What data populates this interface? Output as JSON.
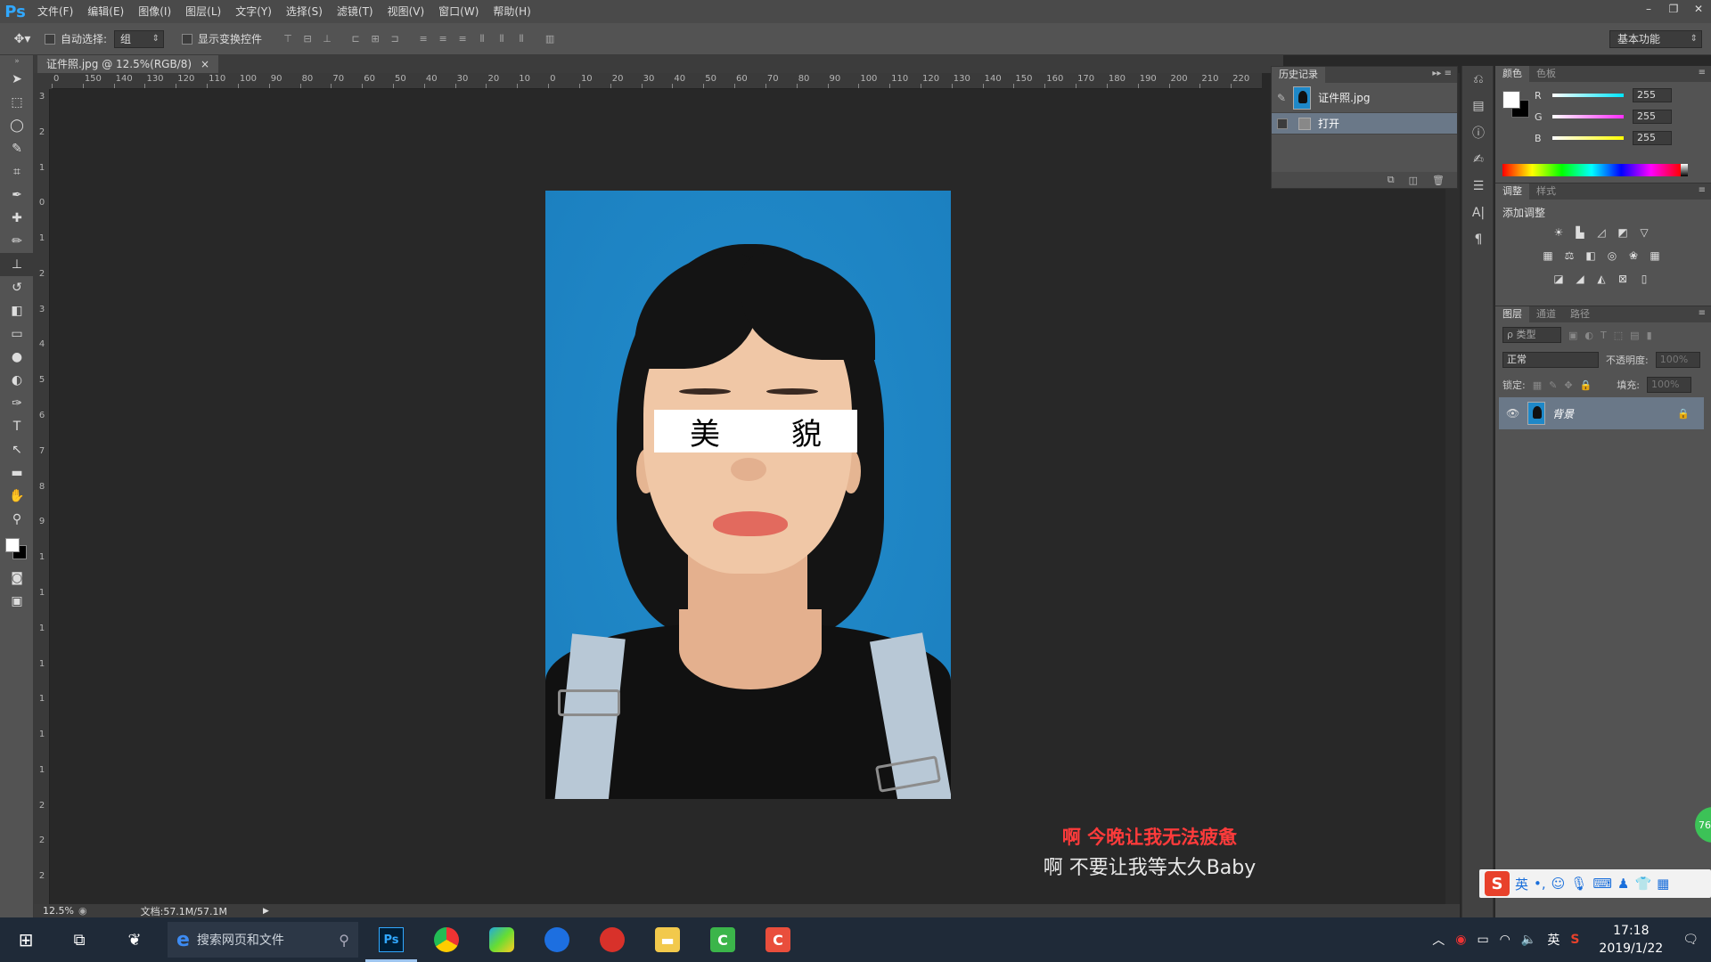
{
  "app": {
    "logo": "Ps",
    "window_controls": [
      "–",
      "❐",
      "✕"
    ]
  },
  "menu": [
    "文件(F)",
    "编辑(E)",
    "图像(I)",
    "图层(L)",
    "文字(Y)",
    "选择(S)",
    "滤镜(T)",
    "视图(V)",
    "窗口(W)",
    "帮助(H)"
  ],
  "options": {
    "auto_select_label": "自动选择:",
    "auto_select_value": "组",
    "show_transform_label": "显示变换控件",
    "workspace": "基本功能"
  },
  "document": {
    "tab_title": "证件照.jpg @ 12.5%(RGB/8)",
    "tab_close": "×",
    "ruler_h": [
      "0",
      "150",
      "140",
      "130",
      "120",
      "110",
      "100",
      "90",
      "80",
      "70",
      "60",
      "50",
      "40",
      "30",
      "20",
      "10",
      "0",
      "10",
      "20",
      "30",
      "40",
      "50",
      "60",
      "70",
      "80",
      "90",
      "100",
      "110",
      "120",
      "130",
      "140",
      "150",
      "160",
      "170",
      "180",
      "190",
      "200",
      "210",
      "220"
    ],
    "ruler_v": [
      "3",
      "2",
      "1",
      "0",
      "1",
      "2",
      "3",
      "4",
      "5",
      "6",
      "7",
      "8",
      "9",
      "1",
      "1",
      "1",
      "1",
      "1",
      "1",
      "1",
      "2",
      "2",
      "2"
    ],
    "mask_text_left": "美",
    "mask_text_right": "貌"
  },
  "subtitles": {
    "line1": "啊 今晚让我无法疲惫",
    "line2": "啊 不要让我等太久Baby"
  },
  "status": {
    "zoom": "12.5%",
    "doc_info": "文档:57.1M/57.1M",
    "arrow": "▶"
  },
  "history": {
    "tabs": [
      "历史记录"
    ],
    "menu": "▸▸ ≡",
    "snapshot": "证件照.jpg",
    "step": "打开"
  },
  "color_panel": {
    "tabs": [
      "颜色",
      "色板"
    ],
    "channels": [
      {
        "label": "R",
        "value": "255",
        "color": "#00e5ff"
      },
      {
        "label": "G",
        "value": "255",
        "color": "#ff2dff"
      },
      {
        "label": "B",
        "value": "255",
        "color": "#ffff00"
      }
    ]
  },
  "adjust_panel": {
    "tabs": [
      "调整",
      "样式"
    ],
    "title": "添加调整"
  },
  "layers_panel": {
    "tabs": [
      "图层",
      "通道",
      "路径"
    ],
    "filter_kind": "ρ 类型",
    "blend_mode": "正常",
    "opacity_label": "不透明度:",
    "opacity_value": "100%",
    "lock_label": "锁定:",
    "fill_label": "填充:",
    "fill_value": "100%",
    "layer_name": "背景"
  },
  "ime": {
    "lang": "英",
    "badge": "76"
  },
  "taskbar": {
    "search_placeholder": "搜索网页和文件",
    "tray_lang": "英",
    "time": "17:18",
    "date": "2019/1/22"
  }
}
